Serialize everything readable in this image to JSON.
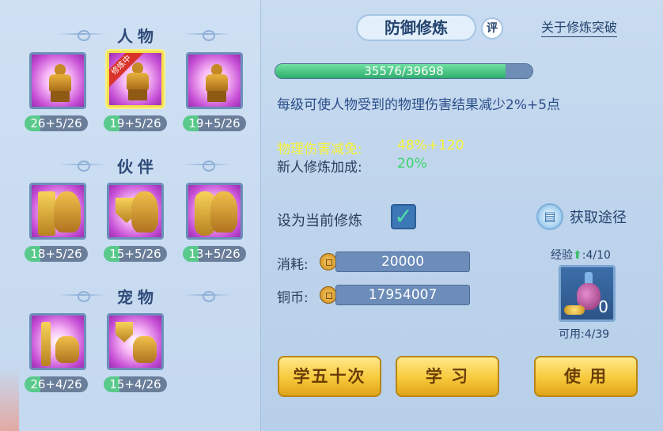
{
  "sections": {
    "character": {
      "title": "人物",
      "slots": [
        {
          "level": "26+5/26",
          "icon": "golden-warrior-meditating-icon",
          "active": false
        },
        {
          "level": "19+5/26",
          "icon": "golden-warrior-shield-icon",
          "active": true,
          "badge": "修炼中"
        },
        {
          "level": "19+5/26",
          "icon": "golden-warrior-standing-icon",
          "active": false
        }
      ]
    },
    "partner": {
      "title": "伙伴",
      "slots": [
        {
          "level": "18+5/26",
          "icon": "partner-sword-lion-icon"
        },
        {
          "level": "15+5/26",
          "icon": "partner-shield-lion-icon"
        },
        {
          "level": "13+5/26",
          "icon": "partner-palm-lion-icon"
        }
      ]
    },
    "pet": {
      "title": "宠物",
      "slots": [
        {
          "level": "26+4/26",
          "icon": "pet-sword-cat-icon"
        },
        {
          "level": "15+4/26",
          "icon": "pet-shield-cat-icon"
        }
      ]
    }
  },
  "header": {
    "tab_title": "防御修炼",
    "review_label": "评",
    "breakthrough_link": "关于修炼突破"
  },
  "progress": {
    "text": "35576/39698",
    "fraction": 0.896
  },
  "description": "每级可使人物受到的物理伤害结果减少2%+5点",
  "stats": {
    "reduction_label": "物理伤害减免:",
    "reduction_value": "48%+120",
    "newbie_label": "新人修炼加成:",
    "newbie_value": "20%"
  },
  "setting": {
    "label": "设为当前修炼",
    "checked": true
  },
  "source_button": "获取途径",
  "cost": {
    "consume_label": "消耗:",
    "consume_value": "20000",
    "copper_label": "铜币:",
    "copper_value": "17954007"
  },
  "item": {
    "exp_label": "经验",
    "exp_value": ":4/10",
    "count": "0",
    "available": "可用:4/39"
  },
  "buttons": {
    "learn_fifty": "学五十次",
    "learn": "学 习",
    "use": "使 用"
  },
  "colors": {
    "stat_yellow": "#f7f23a",
    "stat_green": "#3ed36b",
    "progress_green": "#2fae6b"
  }
}
